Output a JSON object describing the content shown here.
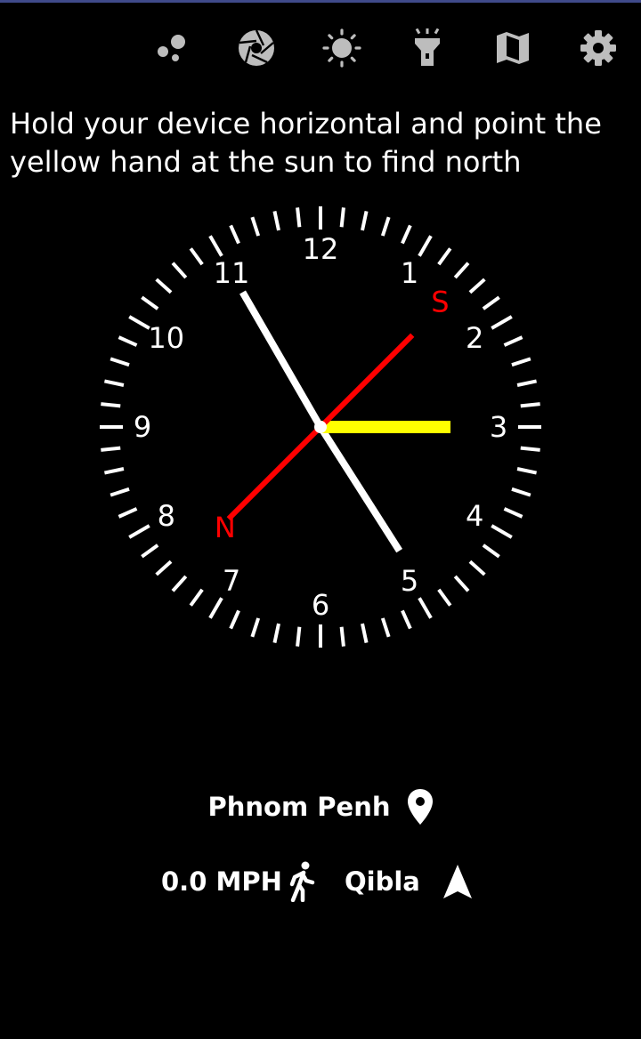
{
  "toolbar": {
    "items": [
      {
        "name": "moon-phases-icon"
      },
      {
        "name": "camera-shutter-icon"
      },
      {
        "name": "brightness-icon"
      },
      {
        "name": "flashlight-icon"
      },
      {
        "name": "map-icon"
      },
      {
        "name": "settings-icon"
      }
    ]
  },
  "instruction": {
    "line1": "Hold your device horizontal and point the",
    "line2": "yellow hand at the sun to find north"
  },
  "clock": {
    "hour_numbers": [
      "12",
      "1",
      "2",
      "3",
      "4",
      "5",
      "6",
      "7",
      "8",
      "9",
      "10",
      "11"
    ],
    "time_hours": 4,
    "time_minutes": 55,
    "sun_direction_hours": 3,
    "south_label": "S",
    "north_label": "N",
    "north_south_angle_deg": 45,
    "colors": {
      "face": "#ffffff",
      "hour_minute_hands": "#ffffff",
      "sun_hand": "#ffff00",
      "north_south_line": "#ff0000",
      "direction_labels": "#ff0000"
    }
  },
  "location": {
    "name": "Phnom Penh",
    "icon": "location-pin-icon"
  },
  "status": {
    "speed": "0.0 MPH",
    "speed_icon": "walking-person-icon",
    "qibla_label": "Qibla",
    "qibla_icon": "navigation-arrow-icon"
  }
}
